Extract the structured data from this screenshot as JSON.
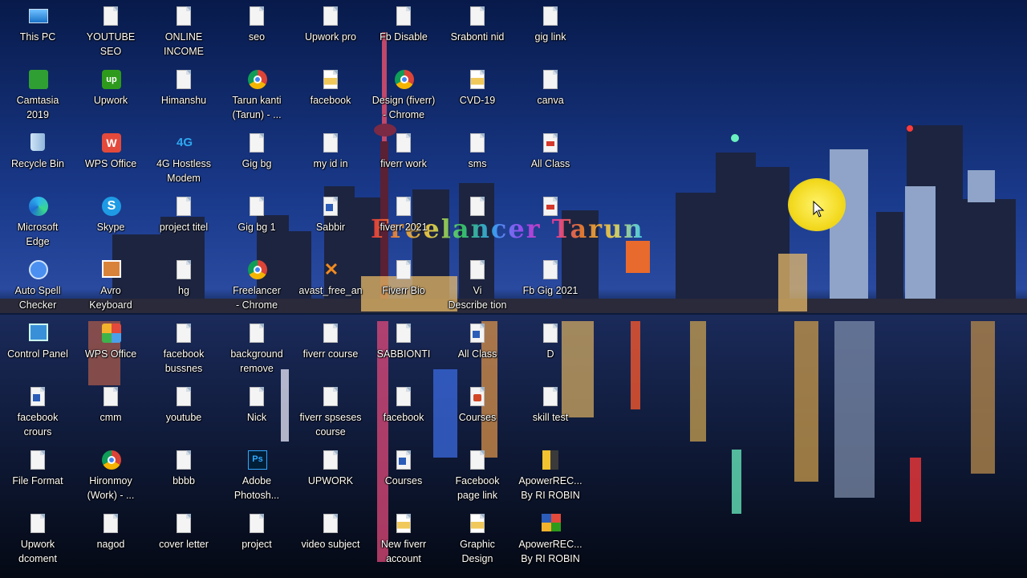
{
  "desktop": {
    "watermark": "Freelancer Tarun",
    "icons": [
      {
        "label": "This PC",
        "icon": "this-pc-icon"
      },
      {
        "label": "YOUTUBE SEO",
        "icon": "document-icon"
      },
      {
        "label": "ONLINE\nINCOME",
        "icon": "document-icon"
      },
      {
        "label": "seo",
        "icon": "document-icon"
      },
      {
        "label": "Upwork pro",
        "icon": "document-icon"
      },
      {
        "label": "Fb Disable",
        "icon": "document-icon"
      },
      {
        "label": "Srabonti nid",
        "icon": "document-icon"
      },
      {
        "label": "gig link",
        "icon": "document-icon"
      },
      {
        "label": "Camtasia\n2019",
        "icon": "camtasia-icon"
      },
      {
        "label": "Upwork",
        "icon": "upwork-icon"
      },
      {
        "label": "Himanshu",
        "icon": "document-icon"
      },
      {
        "label": "Tarun kanti\n(Tarun) - ...",
        "icon": "chrome-icon"
      },
      {
        "label": "facebook",
        "icon": "image-file-icon"
      },
      {
        "label": "Design (fiverr)\n- Chrome",
        "icon": "chrome-icon"
      },
      {
        "label": "CVD-19",
        "icon": "image-file-icon"
      },
      {
        "label": "canva",
        "icon": "document-icon"
      },
      {
        "label": "Recycle Bin",
        "icon": "recycle-bin-icon"
      },
      {
        "label": "WPS Office",
        "icon": "wps-office-icon"
      },
      {
        "label": "4G Hostless\nModem",
        "icon": "modem-icon"
      },
      {
        "label": "Gig bg",
        "icon": "document-icon"
      },
      {
        "label": "my id in",
        "icon": "document-icon"
      },
      {
        "label": "fiverr work",
        "icon": "document-icon"
      },
      {
        "label": "sms",
        "icon": "document-icon"
      },
      {
        "label": "All Class",
        "icon": "pdf-icon"
      },
      {
        "label": "Microsoft\nEdge",
        "icon": "edge-icon"
      },
      {
        "label": "Skype",
        "icon": "skype-icon"
      },
      {
        "label": "project titel",
        "icon": "document-icon"
      },
      {
        "label": "Gig bg 1",
        "icon": "document-icon"
      },
      {
        "label": "Sabbir",
        "icon": "word-icon"
      },
      {
        "label": "fiverr 2021",
        "icon": "document-icon"
      },
      {
        "label": "",
        "icon": "document-icon"
      },
      {
        "label": "",
        "icon": "pdf-icon"
      },
      {
        "label": "Auto Spell\nChecker",
        "icon": "spell-checker-icon"
      },
      {
        "label": "Avro\nKeyboard",
        "icon": "avro-keyboard-icon"
      },
      {
        "label": "hg",
        "icon": "document-icon"
      },
      {
        "label": "Freelancer\n- Chrome",
        "icon": "chrome-icon"
      },
      {
        "label": "avast_free_an",
        "icon": "avast-icon"
      },
      {
        "label": "Fiverr Bio",
        "icon": "document-icon"
      },
      {
        "label": "Vi\nDescribe tion",
        "icon": "document-icon"
      },
      {
        "label": "Fb Gig 2021",
        "icon": "document-icon"
      },
      {
        "label": "Control Panel",
        "icon": "control-panel-icon"
      },
      {
        "label": "WPS Office",
        "icon": "wps-multi-icon"
      },
      {
        "label": "facebook\nbussnes",
        "icon": "document-icon"
      },
      {
        "label": "background\nremove",
        "icon": "document-icon"
      },
      {
        "label": "fiverr course",
        "icon": "document-icon"
      },
      {
        "label": "SABBIONTI",
        "icon": "document-icon"
      },
      {
        "label": "All Class",
        "icon": "word-icon"
      },
      {
        "label": "D",
        "icon": "document-icon"
      },
      {
        "label": "facebook\ncrours",
        "icon": "word-icon"
      },
      {
        "label": "cmm",
        "icon": "document-icon"
      },
      {
        "label": "youtube",
        "icon": "document-icon"
      },
      {
        "label": "Nick",
        "icon": "document-icon"
      },
      {
        "label": "fiverr spseses\ncourse",
        "icon": "document-icon"
      },
      {
        "label": "facebook",
        "icon": "document-icon"
      },
      {
        "label": "Courses",
        "icon": "ppt-icon"
      },
      {
        "label": "skill test",
        "icon": "document-icon"
      },
      {
        "label": "File Format",
        "icon": "document-icon"
      },
      {
        "label": "Hironmoy\n(Work) - ...",
        "icon": "chrome-icon"
      },
      {
        "label": "bbbb",
        "icon": "document-icon"
      },
      {
        "label": "Adobe\nPhotosh...",
        "icon": "photoshop-icon"
      },
      {
        "label": "UPWORK",
        "icon": "document-icon"
      },
      {
        "label": "Courses",
        "icon": "word-icon"
      },
      {
        "label": "Facebook\npage link",
        "icon": "document-icon"
      },
      {
        "label": "ApowerREC...\nBy RI ROBIN",
        "icon": "apowerrec-icon"
      },
      {
        "label": "Upwork\ndcoment",
        "icon": "document-icon"
      },
      {
        "label": "nagod",
        "icon": "document-icon"
      },
      {
        "label": "cover letter",
        "icon": "document-icon"
      },
      {
        "label": "project",
        "icon": "document-icon"
      },
      {
        "label": "video subject",
        "icon": "document-icon"
      },
      {
        "label": "New fiverr\naccount",
        "icon": "image-file-icon"
      },
      {
        "label": "Graphic\nDesign",
        "icon": "image-file-icon"
      },
      {
        "label": "ApowerREC...\nBy RI ROBIN",
        "icon": "apowerrec-multi-icon"
      }
    ]
  }
}
